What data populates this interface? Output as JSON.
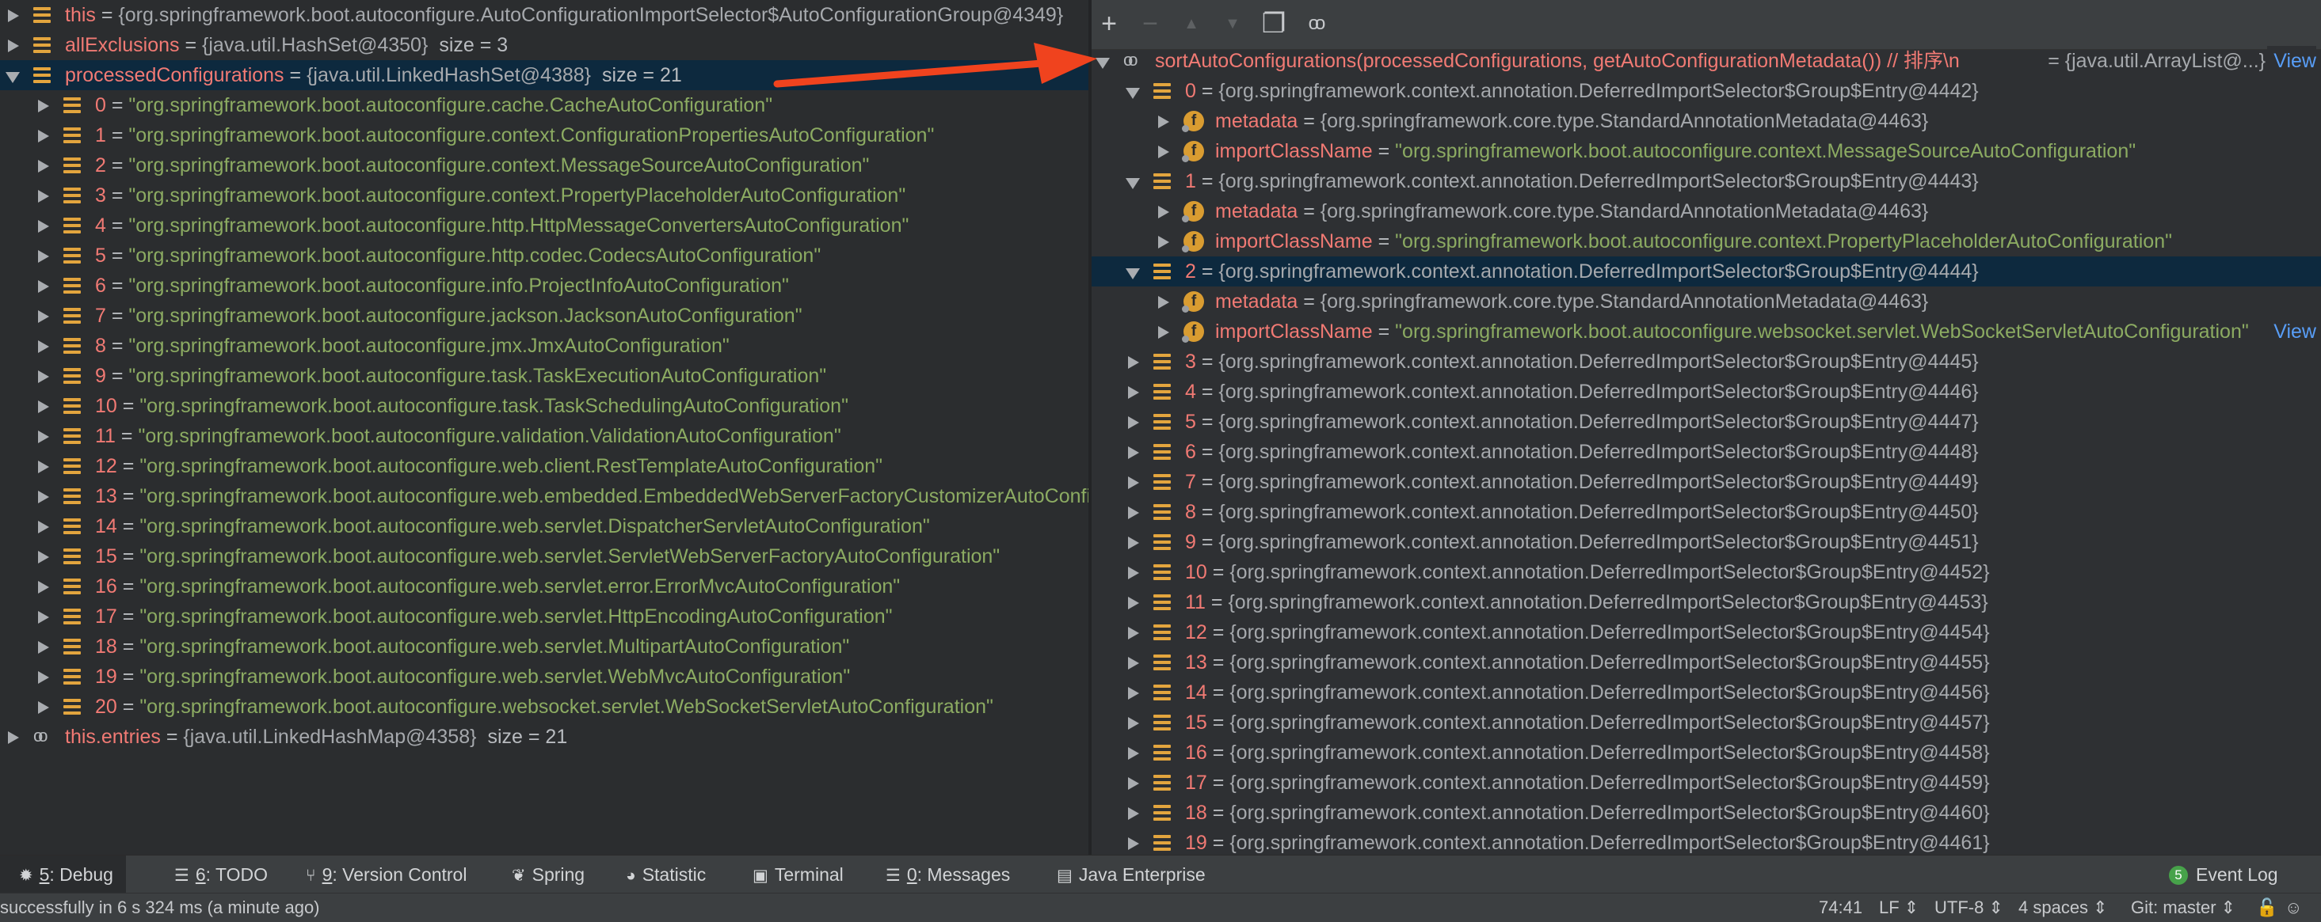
{
  "left_tree": [
    {
      "depth": 0,
      "expanded": false,
      "icon": "field-icon",
      "name": "this",
      "sep": " = ",
      "value": "{org.springframework.boot.autoconfigure.AutoConfigurationImportSelector$AutoConfigurationGroup@4349}",
      "vtype": "obj",
      "size": ""
    },
    {
      "depth": 0,
      "expanded": false,
      "icon": "field-icon",
      "name": "allExclusions",
      "sep": " = ",
      "value": "{java.util.HashSet@4350}",
      "vtype": "obj",
      "size": "size = 3"
    },
    {
      "depth": 0,
      "expanded": true,
      "selected": true,
      "icon": "field-icon",
      "name": "processedConfigurations",
      "sep": " = ",
      "value": "{java.util.LinkedHashSet@4388}",
      "vtype": "obj",
      "size": "size = 21"
    },
    {
      "depth": 1,
      "expanded": false,
      "icon": "field-icon",
      "name": "0",
      "sep": " = ",
      "value": "\"org.springframework.boot.autoconfigure.cache.CacheAutoConfiguration\"",
      "vtype": "str",
      "size": ""
    },
    {
      "depth": 1,
      "expanded": false,
      "icon": "field-icon",
      "name": "1",
      "sep": " = ",
      "value": "\"org.springframework.boot.autoconfigure.context.ConfigurationPropertiesAutoConfiguration\"",
      "vtype": "str",
      "size": ""
    },
    {
      "depth": 1,
      "expanded": false,
      "icon": "field-icon",
      "name": "2",
      "sep": " = ",
      "value": "\"org.springframework.boot.autoconfigure.context.MessageSourceAutoConfiguration\"",
      "vtype": "str",
      "size": ""
    },
    {
      "depth": 1,
      "expanded": false,
      "icon": "field-icon",
      "name": "3",
      "sep": " = ",
      "value": "\"org.springframework.boot.autoconfigure.context.PropertyPlaceholderAutoConfiguration\"",
      "vtype": "str",
      "size": ""
    },
    {
      "depth": 1,
      "expanded": false,
      "icon": "field-icon",
      "name": "4",
      "sep": " = ",
      "value": "\"org.springframework.boot.autoconfigure.http.HttpMessageConvertersAutoConfiguration\"",
      "vtype": "str",
      "size": ""
    },
    {
      "depth": 1,
      "expanded": false,
      "icon": "field-icon",
      "name": "5",
      "sep": " = ",
      "value": "\"org.springframework.boot.autoconfigure.http.codec.CodecsAutoConfiguration\"",
      "vtype": "str",
      "size": ""
    },
    {
      "depth": 1,
      "expanded": false,
      "icon": "field-icon",
      "name": "6",
      "sep": " = ",
      "value": "\"org.springframework.boot.autoconfigure.info.ProjectInfoAutoConfiguration\"",
      "vtype": "str",
      "size": ""
    },
    {
      "depth": 1,
      "expanded": false,
      "icon": "field-icon",
      "name": "7",
      "sep": " = ",
      "value": "\"org.springframework.boot.autoconfigure.jackson.JacksonAutoConfiguration\"",
      "vtype": "str",
      "size": ""
    },
    {
      "depth": 1,
      "expanded": false,
      "icon": "field-icon",
      "name": "8",
      "sep": " = ",
      "value": "\"org.springframework.boot.autoconfigure.jmx.JmxAutoConfiguration\"",
      "vtype": "str",
      "size": ""
    },
    {
      "depth": 1,
      "expanded": false,
      "icon": "field-icon",
      "name": "9",
      "sep": " = ",
      "value": "\"org.springframework.boot.autoconfigure.task.TaskExecutionAutoConfiguration\"",
      "vtype": "str",
      "size": ""
    },
    {
      "depth": 1,
      "expanded": false,
      "icon": "field-icon",
      "name": "10",
      "sep": " = ",
      "value": "\"org.springframework.boot.autoconfigure.task.TaskSchedulingAutoConfiguration\"",
      "vtype": "str",
      "size": ""
    },
    {
      "depth": 1,
      "expanded": false,
      "icon": "field-icon",
      "name": "11",
      "sep": " = ",
      "value": "\"org.springframework.boot.autoconfigure.validation.ValidationAutoConfiguration\"",
      "vtype": "str",
      "size": ""
    },
    {
      "depth": 1,
      "expanded": false,
      "icon": "field-icon",
      "name": "12",
      "sep": " = ",
      "value": "\"org.springframework.boot.autoconfigure.web.client.RestTemplateAutoConfiguration\"",
      "vtype": "str",
      "size": ""
    },
    {
      "depth": 1,
      "expanded": false,
      "icon": "field-icon",
      "name": "13",
      "sep": " = ",
      "value": "\"org.springframework.boot.autoconfigure.web.embedded.EmbeddedWebServerFactoryCustomizerAutoConfiguration\"",
      "vtype": "str",
      "size": ""
    },
    {
      "depth": 1,
      "expanded": false,
      "icon": "field-icon",
      "name": "14",
      "sep": " = ",
      "value": "\"org.springframework.boot.autoconfigure.web.servlet.DispatcherServletAutoConfiguration\"",
      "vtype": "str",
      "size": ""
    },
    {
      "depth": 1,
      "expanded": false,
      "icon": "field-icon",
      "name": "15",
      "sep": " = ",
      "value": "\"org.springframework.boot.autoconfigure.web.servlet.ServletWebServerFactoryAutoConfiguration\"",
      "vtype": "str",
      "size": ""
    },
    {
      "depth": 1,
      "expanded": false,
      "icon": "field-icon",
      "name": "16",
      "sep": " = ",
      "value": "\"org.springframework.boot.autoconfigure.web.servlet.error.ErrorMvcAutoConfiguration\"",
      "vtype": "str",
      "size": ""
    },
    {
      "depth": 1,
      "expanded": false,
      "icon": "field-icon",
      "name": "17",
      "sep": " = ",
      "value": "\"org.springframework.boot.autoconfigure.web.servlet.HttpEncodingAutoConfiguration\"",
      "vtype": "str",
      "size": ""
    },
    {
      "depth": 1,
      "expanded": false,
      "icon": "field-icon",
      "name": "18",
      "sep": " = ",
      "value": "\"org.springframework.boot.autoconfigure.web.servlet.MultipartAutoConfiguration\"",
      "vtype": "str",
      "size": ""
    },
    {
      "depth": 1,
      "expanded": false,
      "icon": "field-icon",
      "name": "19",
      "sep": " = ",
      "value": "\"org.springframework.boot.autoconfigure.web.servlet.WebMvcAutoConfiguration\"",
      "vtype": "str",
      "size": ""
    },
    {
      "depth": 1,
      "expanded": false,
      "icon": "field-icon",
      "name": "20",
      "sep": " = ",
      "value": "\"org.springframework.boot.autoconfigure.websocket.servlet.WebSocketServletAutoConfiguration\"",
      "vtype": "str",
      "size": ""
    },
    {
      "depth": 0,
      "expanded": false,
      "icon": "watch-icon",
      "name": "this.entries",
      "sep": " = ",
      "value": "{java.util.LinkedHashMap@4358}",
      "vtype": "obj",
      "size": "size = 21"
    }
  ],
  "toolbar": {
    "buttons": [
      {
        "name": "add-watch-button",
        "glyph": "+",
        "dim": false
      },
      {
        "name": "remove-watch-button",
        "glyph": "−",
        "dim": true
      },
      {
        "name": "move-up-button",
        "glyph": "▲",
        "dim": true
      },
      {
        "name": "move-down-button",
        "glyph": "▼",
        "dim": true
      },
      {
        "name": "copy-watch-button",
        "glyph": "❐",
        "dim": false
      },
      {
        "name": "show-watches-button",
        "glyph": "oo",
        "dim": false
      }
    ]
  },
  "right_tree": [
    {
      "depth": 0,
      "expanded": true,
      "icon": "watch-icon",
      "name": "sortAutoConfigurations(processedConfigurations, getAutoConfigurationMetadata()) // 排序\\n",
      "sep": "",
      "value": "",
      "vtype": "obj",
      "right_value": "= {java.util.ArrayList@...}",
      "view": "View"
    },
    {
      "depth": 1,
      "expanded": true,
      "icon": "field-icon",
      "name": "0",
      "sep": " = ",
      "value": "{org.springframework.context.annotation.DeferredImportSelector$Group$Entry@4442}",
      "vtype": "obj"
    },
    {
      "depth": 2,
      "expanded": false,
      "icon": "f-icon",
      "name": "metadata",
      "sep": " = ",
      "value": "{org.springframework.core.type.StandardAnnotationMetadata@4463}",
      "vtype": "obj"
    },
    {
      "depth": 2,
      "expanded": false,
      "icon": "f-icon",
      "name": "importClassName",
      "sep": " = ",
      "value": "\"org.springframework.boot.autoconfigure.context.MessageSourceAutoConfiguration\"",
      "vtype": "str"
    },
    {
      "depth": 1,
      "expanded": true,
      "icon": "field-icon",
      "name": "1",
      "sep": " = ",
      "value": "{org.springframework.context.annotation.DeferredImportSelector$Group$Entry@4443}",
      "vtype": "obj"
    },
    {
      "depth": 2,
      "expanded": false,
      "icon": "f-icon",
      "name": "metadata",
      "sep": " = ",
      "value": "{org.springframework.core.type.StandardAnnotationMetadata@4463}",
      "vtype": "obj"
    },
    {
      "depth": 2,
      "expanded": false,
      "icon": "f-icon",
      "name": "importClassName",
      "sep": " = ",
      "value": "\"org.springframework.boot.autoconfigure.context.PropertyPlaceholderAutoConfiguration\"",
      "vtype": "str"
    },
    {
      "depth": 1,
      "expanded": true,
      "selected": true,
      "icon": "field-icon",
      "name": "2",
      "sep": " = ",
      "value": "{org.springframework.context.annotation.DeferredImportSelector$Group$Entry@4444}",
      "vtype": "obj"
    },
    {
      "depth": 2,
      "expanded": false,
      "icon": "f-icon",
      "name": "metadata",
      "sep": " = ",
      "value": "{org.springframework.core.type.StandardAnnotationMetadata@4463}",
      "vtype": "obj"
    },
    {
      "depth": 2,
      "expanded": false,
      "icon": "f-icon",
      "name": "importClassName",
      "sep": " = ",
      "value": "\"org.springframework.boot.autoconfigure.websocket.servlet.WebSocketServletAutoConfiguration\"",
      "vtype": "str",
      "view": "View"
    },
    {
      "depth": 1,
      "expanded": false,
      "icon": "field-icon",
      "name": "3",
      "sep": " = ",
      "value": "{org.springframework.context.annotation.DeferredImportSelector$Group$Entry@4445}",
      "vtype": "obj"
    },
    {
      "depth": 1,
      "expanded": false,
      "icon": "field-icon",
      "name": "4",
      "sep": " = ",
      "value": "{org.springframework.context.annotation.DeferredImportSelector$Group$Entry@4446}",
      "vtype": "obj"
    },
    {
      "depth": 1,
      "expanded": false,
      "icon": "field-icon",
      "name": "5",
      "sep": " = ",
      "value": "{org.springframework.context.annotation.DeferredImportSelector$Group$Entry@4447}",
      "vtype": "obj"
    },
    {
      "depth": 1,
      "expanded": false,
      "icon": "field-icon",
      "name": "6",
      "sep": " = ",
      "value": "{org.springframework.context.annotation.DeferredImportSelector$Group$Entry@4448}",
      "vtype": "obj"
    },
    {
      "depth": 1,
      "expanded": false,
      "icon": "field-icon",
      "name": "7",
      "sep": " = ",
      "value": "{org.springframework.context.annotation.DeferredImportSelector$Group$Entry@4449}",
      "vtype": "obj"
    },
    {
      "depth": 1,
      "expanded": false,
      "icon": "field-icon",
      "name": "8",
      "sep": " = ",
      "value": "{org.springframework.context.annotation.DeferredImportSelector$Group$Entry@4450}",
      "vtype": "obj"
    },
    {
      "depth": 1,
      "expanded": false,
      "icon": "field-icon",
      "name": "9",
      "sep": " = ",
      "value": "{org.springframework.context.annotation.DeferredImportSelector$Group$Entry@4451}",
      "vtype": "obj"
    },
    {
      "depth": 1,
      "expanded": false,
      "icon": "field-icon",
      "name": "10",
      "sep": " = ",
      "value": "{org.springframework.context.annotation.DeferredImportSelector$Group$Entry@4452}",
      "vtype": "obj"
    },
    {
      "depth": 1,
      "expanded": false,
      "icon": "field-icon",
      "name": "11",
      "sep": " = ",
      "value": "{org.springframework.context.annotation.DeferredImportSelector$Group$Entry@4453}",
      "vtype": "obj"
    },
    {
      "depth": 1,
      "expanded": false,
      "icon": "field-icon",
      "name": "12",
      "sep": " = ",
      "value": "{org.springframework.context.annotation.DeferredImportSelector$Group$Entry@4454}",
      "vtype": "obj"
    },
    {
      "depth": 1,
      "expanded": false,
      "icon": "field-icon",
      "name": "13",
      "sep": " = ",
      "value": "{org.springframework.context.annotation.DeferredImportSelector$Group$Entry@4455}",
      "vtype": "obj"
    },
    {
      "depth": 1,
      "expanded": false,
      "icon": "field-icon",
      "name": "14",
      "sep": " = ",
      "value": "{org.springframework.context.annotation.DeferredImportSelector$Group$Entry@4456}",
      "vtype": "obj"
    },
    {
      "depth": 1,
      "expanded": false,
      "icon": "field-icon",
      "name": "15",
      "sep": " = ",
      "value": "{org.springframework.context.annotation.DeferredImportSelector$Group$Entry@4457}",
      "vtype": "obj"
    },
    {
      "depth": 1,
      "expanded": false,
      "icon": "field-icon",
      "name": "16",
      "sep": " = ",
      "value": "{org.springframework.context.annotation.DeferredImportSelector$Group$Entry@4458}",
      "vtype": "obj"
    },
    {
      "depth": 1,
      "expanded": false,
      "icon": "field-icon",
      "name": "17",
      "sep": " = ",
      "value": "{org.springframework.context.annotation.DeferredImportSelector$Group$Entry@4459}",
      "vtype": "obj"
    },
    {
      "depth": 1,
      "expanded": false,
      "icon": "field-icon",
      "name": "18",
      "sep": " = ",
      "value": "{org.springframework.context.annotation.DeferredImportSelector$Group$Entry@4460}",
      "vtype": "obj"
    },
    {
      "depth": 1,
      "expanded": false,
      "icon": "field-icon",
      "name": "19",
      "sep": " = ",
      "value": "{org.springframework.context.annotation.DeferredImportSelector$Group$Entry@4461}",
      "vtype": "obj"
    }
  ],
  "tool_windows": [
    {
      "name": "debug",
      "num": "5",
      "label": ": Debug",
      "icon": "bug-icon",
      "glyph": "✹",
      "active": true
    },
    {
      "name": "todo",
      "num": "6",
      "label": ": TODO",
      "icon": "list-icon",
      "glyph": "☰",
      "active": false
    },
    {
      "name": "version-control",
      "num": "9",
      "label": ": Version Control",
      "icon": "branch-icon",
      "glyph": "⑂",
      "active": false
    },
    {
      "name": "spring",
      "num": "",
      "label": "Spring",
      "icon": "leaf-icon",
      "glyph": "❦",
      "active": false
    },
    {
      "name": "statistic",
      "num": "",
      "label": "Statistic",
      "icon": "pie-icon",
      "glyph": "◕",
      "active": false
    },
    {
      "name": "terminal",
      "num": "",
      "label": "Terminal",
      "icon": "terminal-icon",
      "glyph": "▣",
      "active": false
    },
    {
      "name": "messages",
      "num": "0",
      "label": ": Messages",
      "icon": "messages-icon",
      "glyph": "☰",
      "active": false
    },
    {
      "name": "java-enterprise",
      "num": "",
      "label": "Java Enterprise",
      "icon": "enterprise-icon",
      "glyph": "▤",
      "active": false
    }
  ],
  "event_log": {
    "count": "5",
    "label": "Event Log"
  },
  "status": {
    "message": "successfully in 6 s 324 ms (a minute ago)",
    "position": "74:41",
    "line_sep": "LF ⇕",
    "encoding": "UTF-8 ⇕",
    "indent": "4 spaces ⇕",
    "vcs": "Git: master ⇕"
  },
  "colors": {
    "name": "#f17a74",
    "string": "#8cab62",
    "object": "#a6a9ad",
    "link": "#589df6",
    "arrow": "#f0431e",
    "selection": "#0d293e"
  }
}
